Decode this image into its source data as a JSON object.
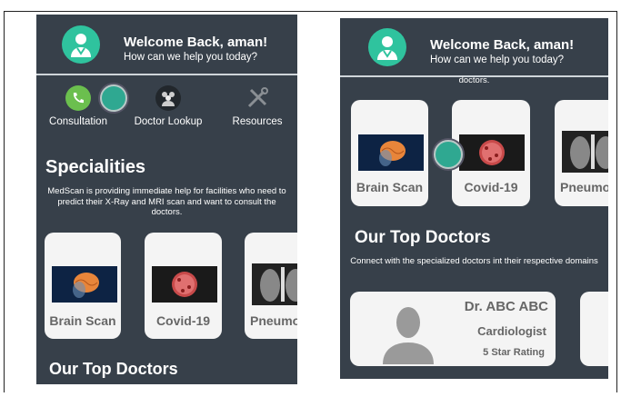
{
  "left_screen": {
    "header": {
      "greeting": "Welcome Back, aman!",
      "subtitle": "How can we help you today?"
    },
    "services": [
      {
        "label": "Consultation",
        "icon": "phone-icon"
      },
      {
        "label": "Doctor Lookup",
        "icon": "doctors-icon"
      },
      {
        "label": "Resources",
        "icon": "tools-icon"
      }
    ],
    "specialities_title": "Specialities",
    "specialities_desc": "MedScan is providing immediate help for facilities who need to predict their X-Ray and MRI scan and want to consult the doctors.",
    "cards": [
      {
        "label": "Brain Scan"
      },
      {
        "label": "Covid-19"
      },
      {
        "label": "Pneumo"
      }
    ],
    "top_doctors_title": "Our Top Doctors"
  },
  "right_screen": {
    "header": {
      "greeting": "Welcome Back, aman!",
      "subtitle": "How can we help you today?"
    },
    "scrolled_text": "doctors.",
    "cards": [
      {
        "label": "Brain Scan"
      },
      {
        "label": "Covid-19"
      },
      {
        "label": "Pneumo"
      }
    ],
    "top_doctors_title": "Our Top Doctors",
    "top_doctors_desc": "Connect with the specialized doctors int their respective domains",
    "doctor": {
      "name": "Dr. ABC ABC",
      "specialty": "Cardiologist",
      "rating": "5 Star Rating"
    }
  },
  "colors": {
    "background": "#37404a",
    "accent": "#2fc39e",
    "card": "#f4f4f4"
  }
}
